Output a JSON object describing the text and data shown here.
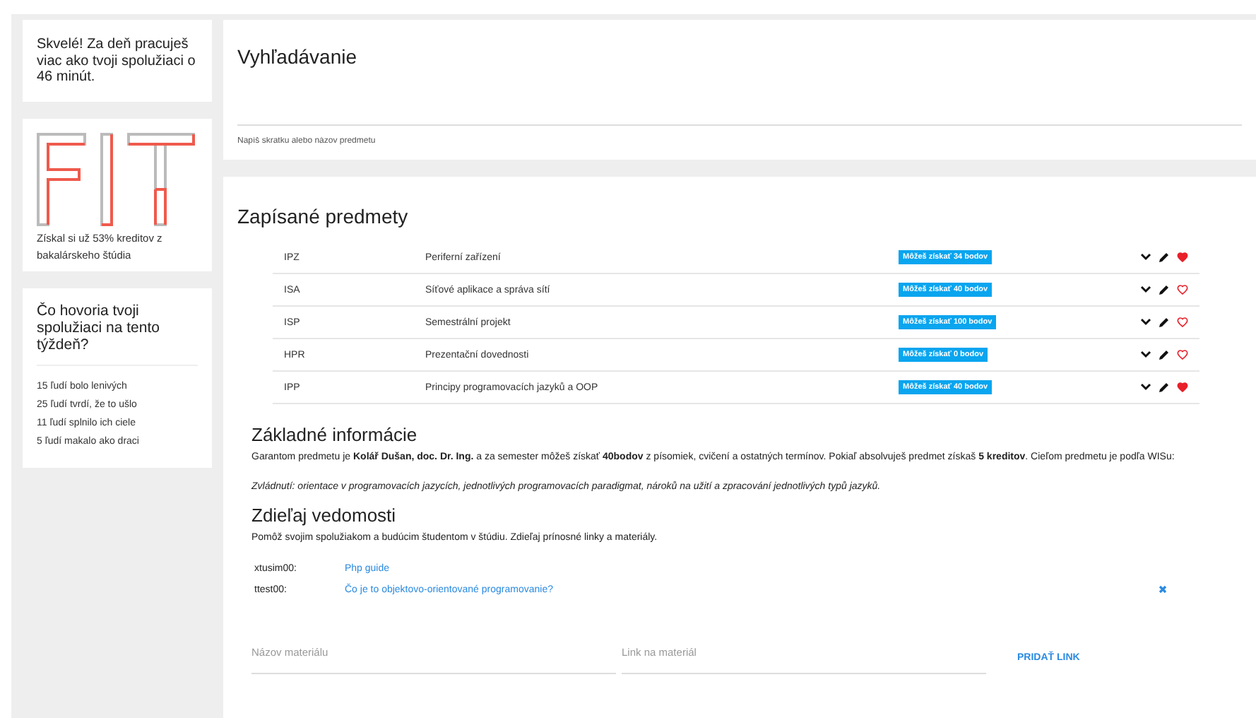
{
  "sidebar": {
    "motivation": "Skvelé! Za deň pracuješ viac ako tvoji spolužiaci o 46 minút.",
    "progress": {
      "text": "Získal si už 53% kreditov z bakalárskeho štúdia"
    },
    "survey": {
      "title": "Čo hovoria tvoji spolužiaci na tento týždeň?",
      "items": [
        "15 ľudí bolo lenivých",
        "25 ľudí tvrdí, že to ušlo",
        "11 ľudí splnilo ich ciele",
        "5 ľudí makalo ako draci"
      ]
    }
  },
  "search": {
    "title": "Vyhľadávanie",
    "placeholder": "Napíš skratku alebo názov predmetu"
  },
  "courses": {
    "title": "Zapísané predmety",
    "rows": [
      {
        "code": "IPZ",
        "name": "Periferní zařízení",
        "badge": "Môžeš získať 34 bodov",
        "favorite": true
      },
      {
        "code": "ISA",
        "name": "Síťové aplikace a správa sítí",
        "badge": "Môžeš získať 40 bodov",
        "favorite": false
      },
      {
        "code": "ISP",
        "name": "Semestrální projekt",
        "badge": "Môžeš získať 100 bodov",
        "favorite": false
      },
      {
        "code": "HPR",
        "name": "Prezentační dovednosti",
        "badge": "Môžeš získať 0 bodov",
        "favorite": false
      },
      {
        "code": "IPP",
        "name": "Principy programovacích jazyků a OOP",
        "badge": "Môžeš získať 40 bodov",
        "favorite": true
      }
    ]
  },
  "info": {
    "title": "Základné informácie",
    "text": "Garantom predmetu je **Kolář Dušan, doc. Dr. Ing.** a za semester môžeš získať **40bodov** z písomiek, cvičení a ostatných termínov. Pokiaľ absolvuješ predmet získaš **5 kreditov**. Cieľom predmetu je podľa WISu:",
    "goal": "Zvládnutí: orientace v programovacích jazycích, jednotlivých programovacích paradigmat, nároků na užití a zpracování jednotlivých typů jazyků."
  },
  "share": {
    "title": "Zdieľaj vedomosti",
    "text": "Pomôž svojim spolužiakom a budúcim študentom v štúdiu. Zdieľaj prínosné linky a materiály.",
    "links": [
      {
        "user": "xtusim00:",
        "title": "Php guide",
        "removable": false
      },
      {
        "user": "ttest00:",
        "title": "Čo je to objektovo-orientované programovanie?",
        "removable": true
      }
    ],
    "name_placeholder": "Názov materiálu",
    "link_placeholder": "Link na materiál",
    "button": "PRIDAŤ LINK"
  }
}
